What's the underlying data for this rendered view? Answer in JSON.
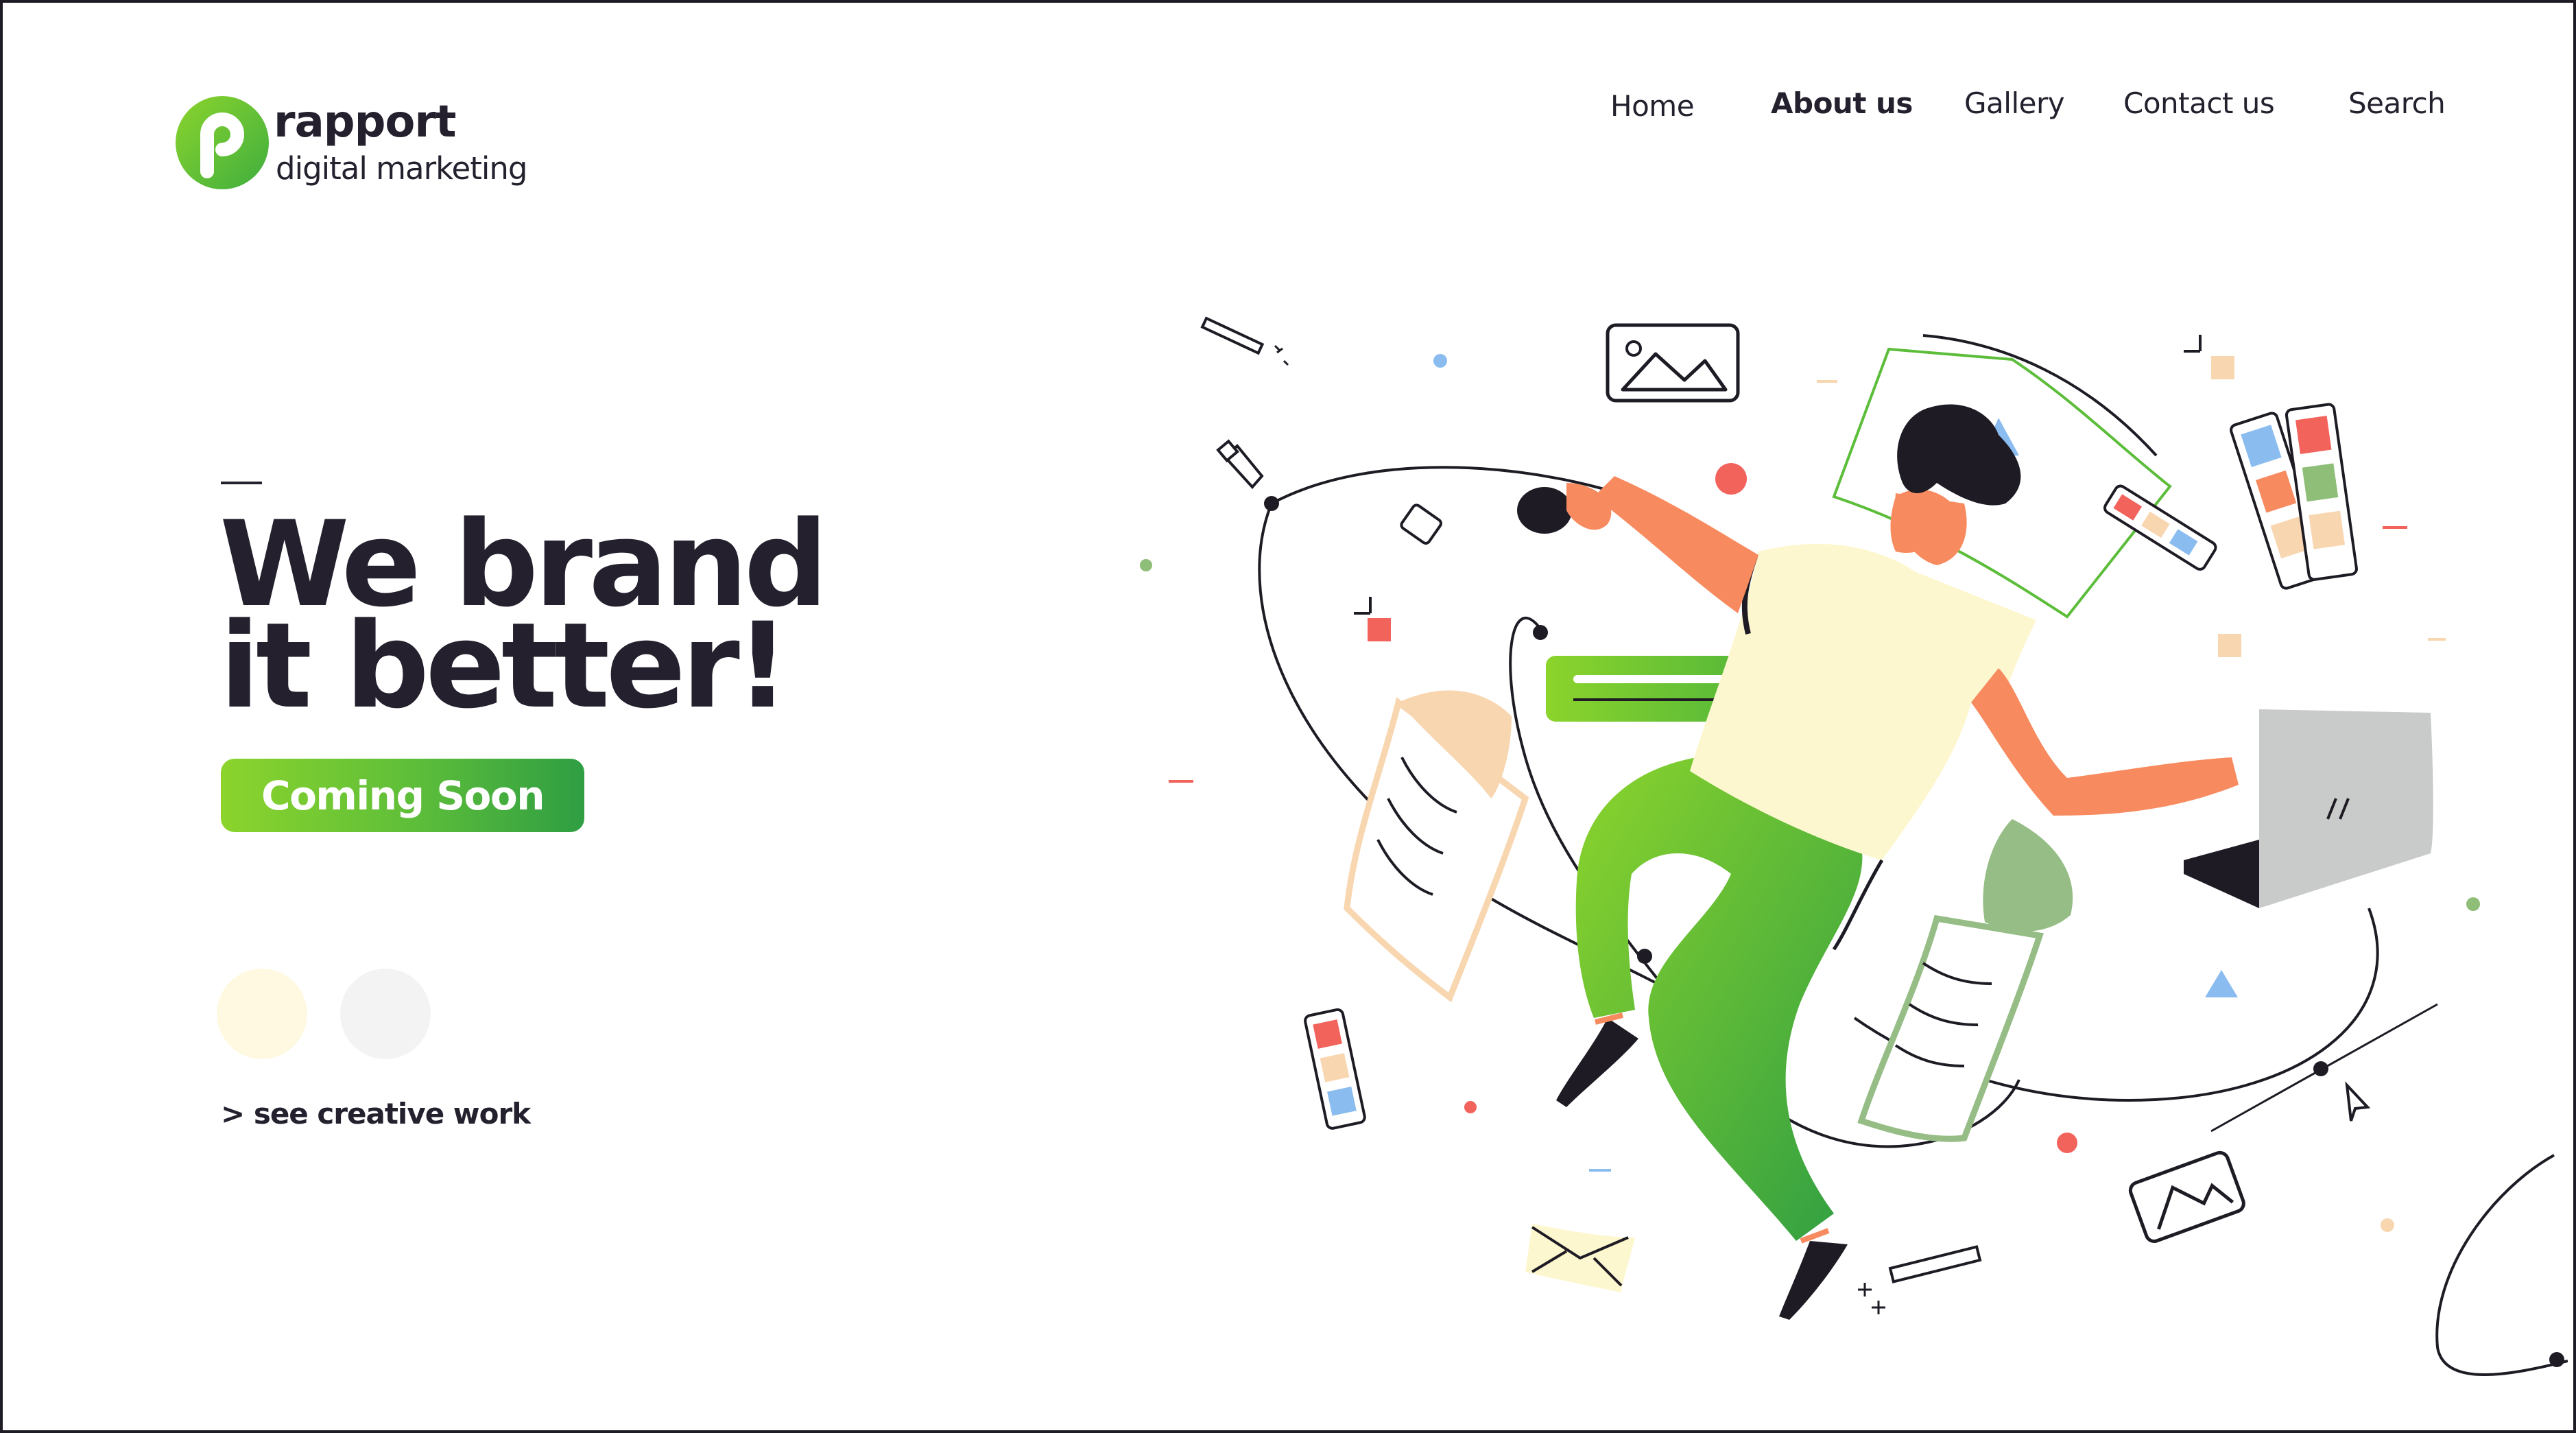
{
  "brand": {
    "name": "rapport",
    "tagline": "digital marketing",
    "logo_color": "#5cbd3a"
  },
  "nav": {
    "items": [
      {
        "label": "Home"
      },
      {
        "label": "About us",
        "active": true
      },
      {
        "label": "Gallery"
      },
      {
        "label": "Contact us"
      },
      {
        "label": "Search"
      }
    ]
  },
  "hero": {
    "headline_line1": "We brand",
    "headline_line2": "it better!",
    "cta_label": "Coming Soon",
    "link_label": "> see creative work",
    "slider_dots": 2,
    "active_dot": 0
  },
  "colors": {
    "text": "#24202e",
    "green_start": "#8cd42c",
    "green_end": "#2f9e43",
    "skin": "#f78b5f",
    "shirt": "#fdf7cf",
    "laptop": "#c9cbcb",
    "accent_red": "#f2635c",
    "accent_blue": "#8bbcf0"
  },
  "illustration": {
    "subject": "person-floating-with-laptop",
    "icons": [
      "image-icon",
      "pen-tool-icon",
      "color-swatch-icon",
      "document-icon",
      "envelope-icon",
      "cursor-icon",
      "laptop-icon"
    ]
  }
}
